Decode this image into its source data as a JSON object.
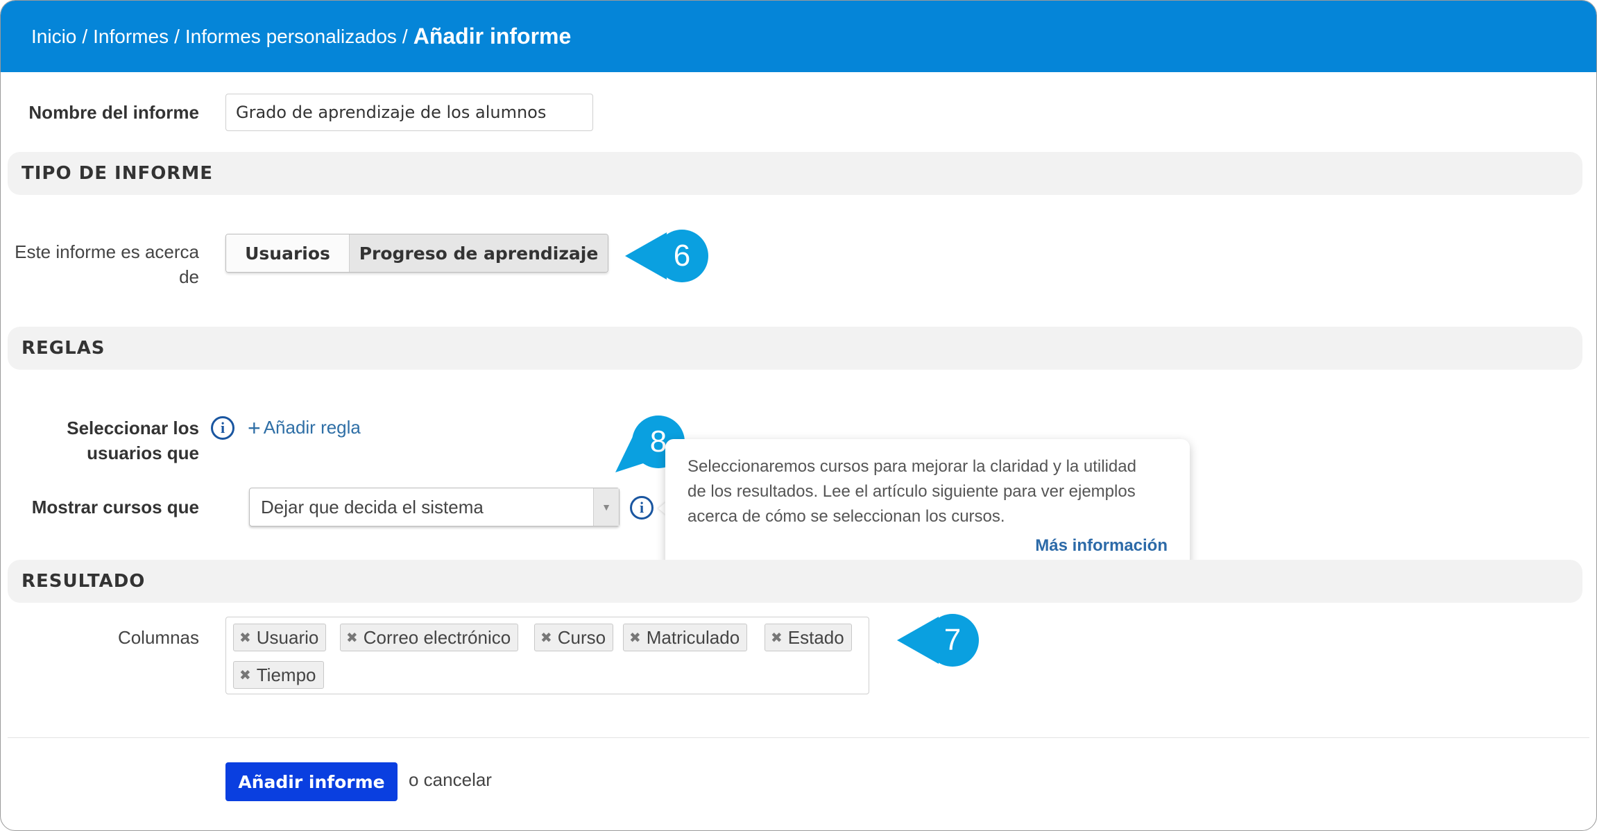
{
  "breadcrumb": {
    "items": [
      "Inicio",
      "Informes",
      "Informes personalizados"
    ],
    "separator": "/",
    "current": "Añadir informe"
  },
  "report_name": {
    "label": "Nombre del informe",
    "value": "Grado de aprendizaje de los alumnos"
  },
  "sections": {
    "report_type": "TIPO DE INFORME",
    "rules": "REGLAS",
    "result": "RESULTADO"
  },
  "report_type": {
    "label_line1": "Este informe es acerca",
    "label_line2": "de",
    "options": [
      "Usuarios",
      "Progreso de aprendizaje"
    ],
    "selected": "Progreso de aprendizaje"
  },
  "rules": {
    "select_users_label_line1": "Seleccionar los",
    "select_users_label_line2": "usuarios que",
    "add_rule_label": "Añadir regla",
    "show_courses_label": "Mostrar cursos que",
    "show_courses_value": "Dejar que decida el sistema"
  },
  "tooltip": {
    "line1": "Seleccionaremos cursos para mejorar la claridad y la utilidad",
    "line2": "de los resultados. Lee el artículo siguiente para ver ejemplos",
    "line3": "acerca de cómo se seleccionan los cursos.",
    "link": "Más información"
  },
  "result": {
    "columns_label": "Columnas",
    "columns": [
      "Usuario",
      "Correo electrónico",
      "Curso",
      "Matriculado",
      "Estado",
      "Tiempo"
    ]
  },
  "actions": {
    "submit": "Añadir informe",
    "cancel": "o cancelar"
  },
  "callouts": [
    "6",
    "7",
    "8"
  ],
  "colors": {
    "header": "#0585d8",
    "callout": "#0aa0e0",
    "primary_button": "#0a3fe0",
    "link": "#2f6fa6"
  }
}
